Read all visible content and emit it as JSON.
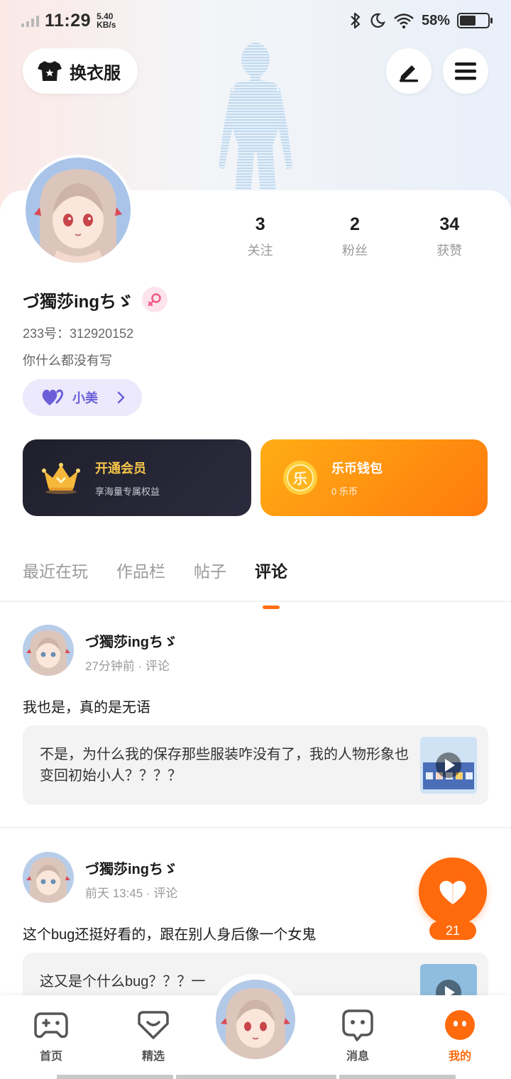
{
  "status_bar": {
    "time": "11:29",
    "speed_value": "5.40",
    "speed_unit": "KB/s",
    "battery": "58%",
    "battery_level": 0.58
  },
  "header": {
    "dress_label": "换衣服",
    "edit_icon": "pen-icon",
    "menu_icon": "hamburger-menu-icon"
  },
  "stats": [
    {
      "value": "3",
      "label": "关注"
    },
    {
      "value": "2",
      "label": "粉丝"
    },
    {
      "value": "34",
      "label": "获赞"
    }
  ],
  "profile": {
    "name": "づ獨莎ingちゞ",
    "uid": "233号：312920152",
    "bio": "你什么都没有写",
    "pal_tag": "小美"
  },
  "promos": {
    "vip_title": "开通会员",
    "vip_sub": "享海量专属权益",
    "wallet_title": "乐币钱包",
    "wallet_sub": "0 乐币",
    "wallet_coin_char": "乐"
  },
  "tabs": [
    {
      "label": "最近在玩",
      "active": false
    },
    {
      "label": "作品栏",
      "active": false
    },
    {
      "label": "帖子",
      "active": false
    },
    {
      "label": "评论",
      "active": true
    }
  ],
  "posts": [
    {
      "user": "づ獨莎ingちゞ",
      "meta": "27分钟前 · 评论",
      "text": "我也是，真的是无语",
      "quote": "不是，为什么我的保存那些服装咋没有了，我的人物形象也变回初始小人？？？？"
    },
    {
      "user": "づ獨莎ingちゞ",
      "meta": "前天 13:45 · 评论",
      "text": "这个bug还挺好看的，跟在别人身后像一个女鬼",
      "quote": "这又是个什么bug？？？一"
    }
  ],
  "like": {
    "count": "21"
  },
  "bottom_nav": [
    {
      "label": "首页",
      "icon": "gamepad-icon",
      "active": false
    },
    {
      "label": "精选",
      "icon": "heart-box-icon",
      "active": false
    },
    {
      "label": "消息",
      "icon": "chat-face-icon",
      "active": false
    },
    {
      "label": "我的",
      "icon": "profile-face-icon",
      "active": true
    }
  ],
  "colors": {
    "accent": "#ff6a0c",
    "vip_gold": "#f7c54a",
    "pal_purple": "#6b5ed8"
  }
}
